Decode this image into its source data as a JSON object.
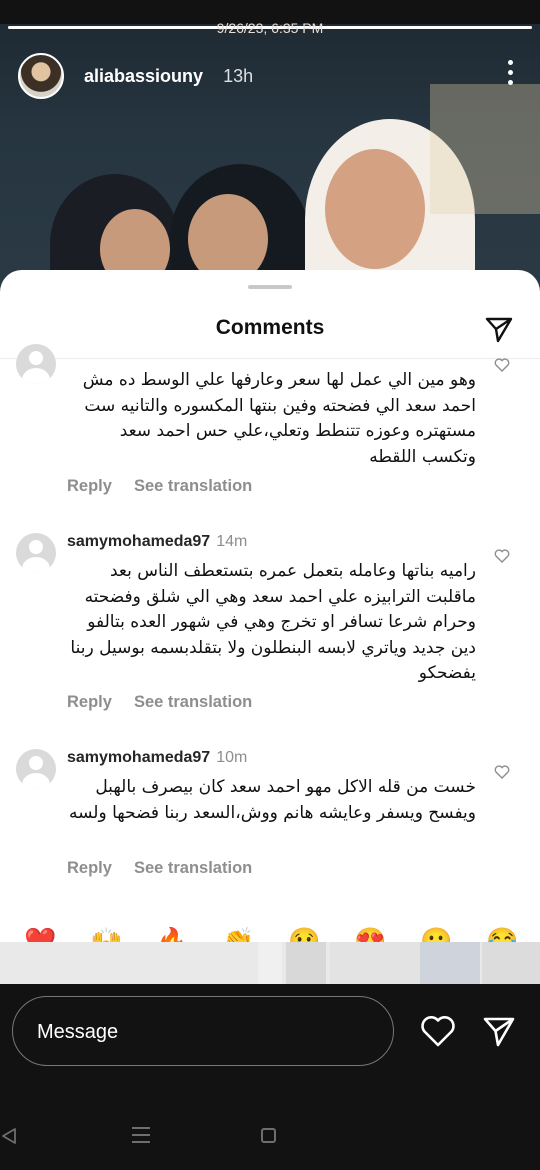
{
  "status_bar": {
    "timestamp": "9/26/23, 6:35 PM"
  },
  "story": {
    "progress": 1.0,
    "username": "aliabassiouny",
    "time_ago": "13h",
    "more_icon": "more-vertical-icon"
  },
  "comments_sheet": {
    "title": "Comments",
    "share_icon": "send-icon",
    "comments": [
      {
        "username": "",
        "time": "",
        "text": "وهو مين الي عمل لها سعر وعارفها علي الوسط ده مش احمد سعد الي فضحته وفين بنتها المكسوره والتانيه ست مستهتره وعوزه تتنطط وتعلي،علي حس احمد سعد وتكسب اللقطه",
        "reply_label": "Reply",
        "translate_label": "See translation"
      },
      {
        "username": "samymohameda97",
        "time": "14m",
        "text": "راميه بناتها وعامله بتعمل عمره بتستعطف الناس بعد ماقلبت الترابيزه علي احمد سعد وهي الي شلق وفضحته وحرام شرعا تسافر او تخرج وهي في شهور العده بتالفو دين جديد وياتري لابسه البنطلون ولا بتقلدبسمه بوسيل ربنا يفضحكو",
        "reply_label": "Reply",
        "translate_label": "See translation"
      },
      {
        "username": "samymohameda97",
        "time": "10m",
        "text": "خست من قله الاكل مهو احمد سعد كان بيصرف بالهبل ويفسح ويسفر وعايشه هانم ووش،السعد ربنا فضحها ولسه",
        "reply_label": "Reply",
        "translate_label": "See translation"
      }
    ],
    "reaction_emojis": [
      "❤️",
      "🙌",
      "🔥",
      "👏",
      "😢",
      "😍",
      "😮",
      "😂"
    ]
  },
  "message_bar": {
    "placeholder": "Message",
    "heart_icon": "heart-icon",
    "send_icon": "send-icon"
  },
  "nav_bar": {
    "recents_icon": "recents-icon",
    "home_icon": "home-icon",
    "back_icon": "back-icon"
  }
}
